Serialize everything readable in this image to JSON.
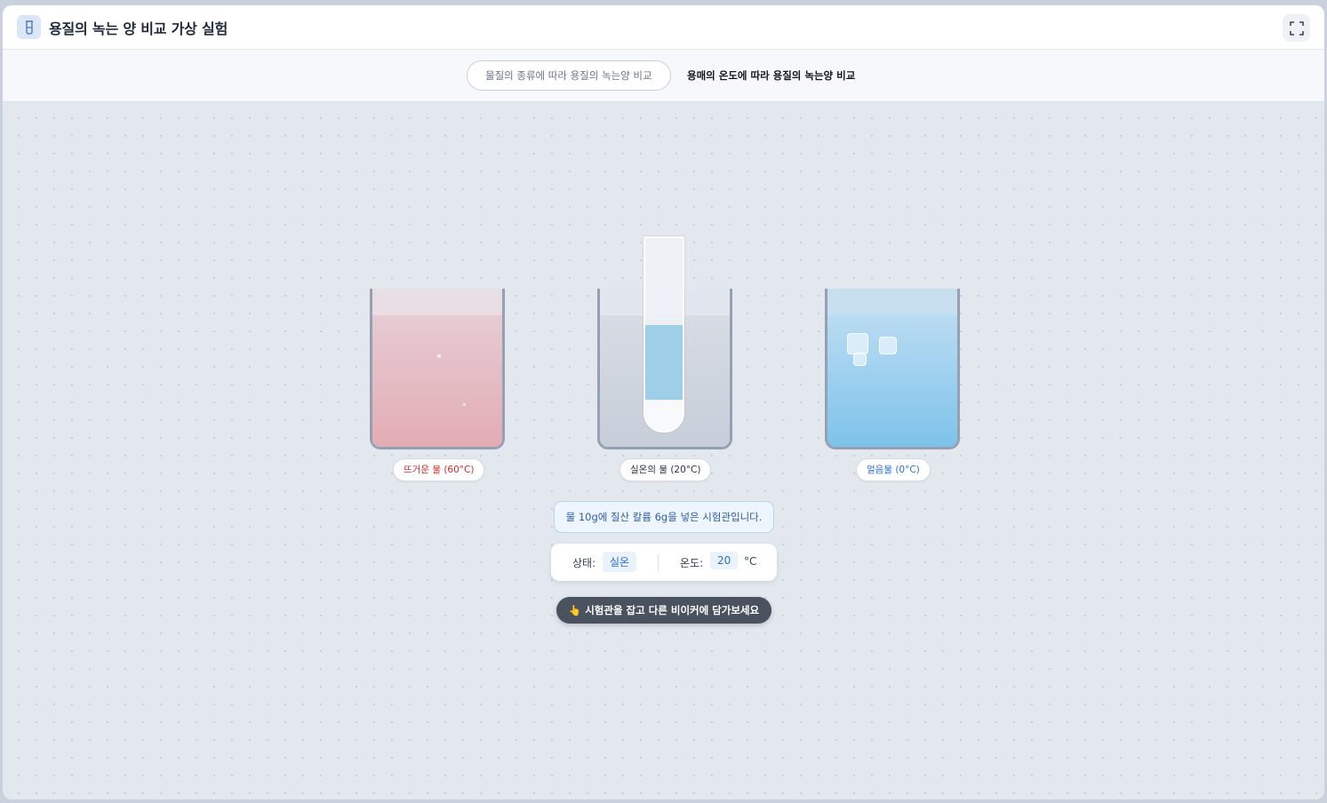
{
  "app": {
    "title": "용질의 녹는 양 비교 가상 실험",
    "icon": "beaker-icon",
    "fullscreen_icon": "fullscreen-icon"
  },
  "tabs": [
    {
      "label": "물질의 종류에 따라 용질의 녹는양 비교",
      "active": false
    },
    {
      "label": "용매의 온도에 따라 용질의 녹는양 비교",
      "active": true
    }
  ],
  "beakers": [
    {
      "label": "뜨거운 물 (60°C)",
      "color": "#e3acb4",
      "label_color": "#d12b2b"
    },
    {
      "label": "실온의 물 (20°C)",
      "color": "#c8ced9",
      "label_color": "#2a3240"
    },
    {
      "label": "얼음물 (0°C)",
      "color": "#7ec2ea",
      "label_color": "#2c6fd6"
    }
  ],
  "info": "물 10g에 질산 칼륨 6g을 넣은 시험관입니다.",
  "status": {
    "state_label": "상태:",
    "state_value": "실온",
    "temp_label": "온도:",
    "temp_value": "20",
    "temp_unit": "°C"
  },
  "hint": "👆 시험관을 잡고 다른 비이커에 담가보세요",
  "colors": {
    "accent": "#2b6fd0",
    "hint_bg": "#4a5260",
    "tube_liquid": "#9fcfe8"
  }
}
